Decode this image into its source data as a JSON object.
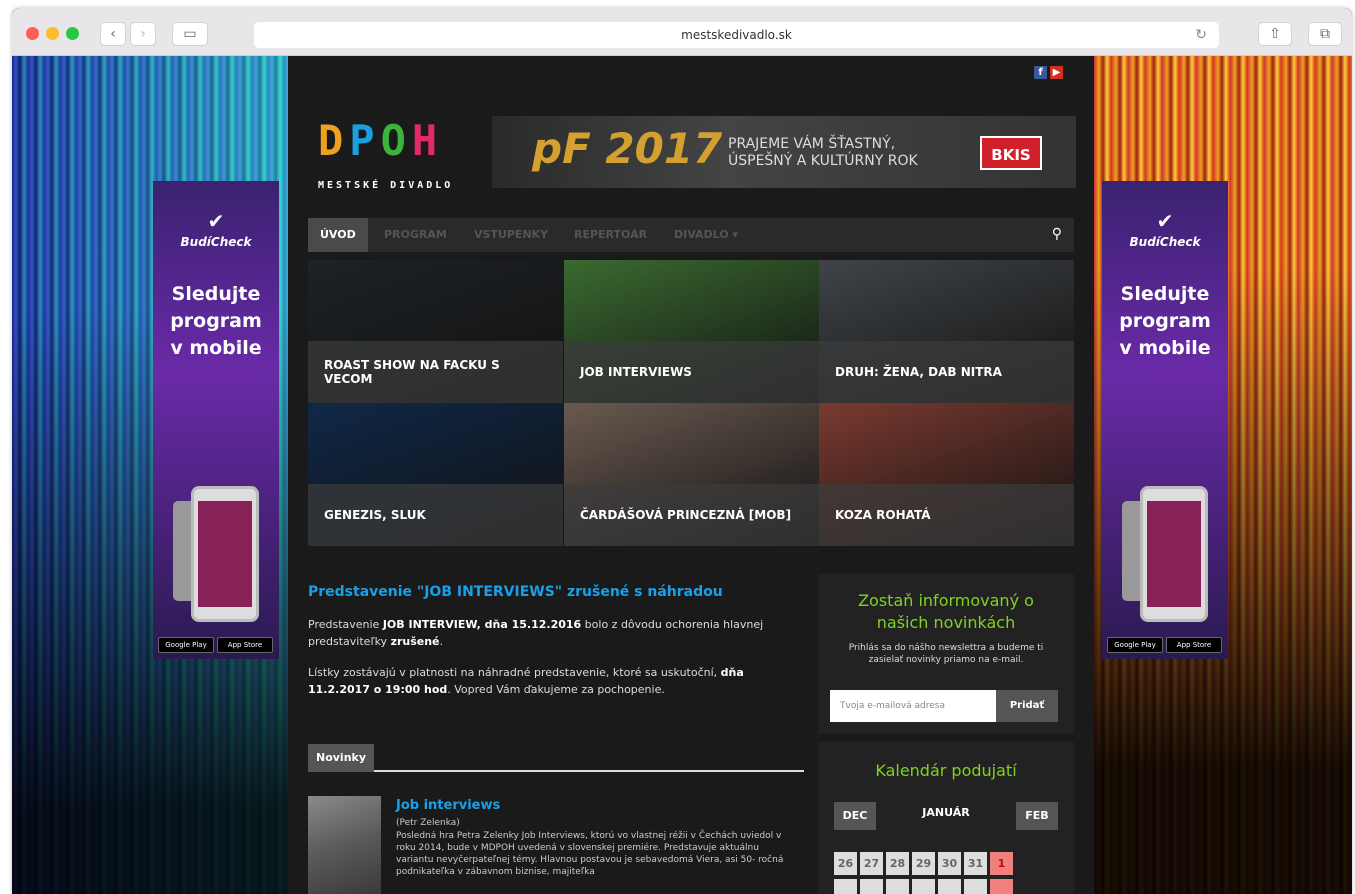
{
  "browser": {
    "url": "mestskedivadlo.sk"
  },
  "colors": {
    "accent_blue": "#18a0e8",
    "accent_green": "#7ed321",
    "bkis_red": "#d0202a"
  },
  "social": [
    {
      "name": "facebook-icon",
      "label": "f"
    },
    {
      "name": "youtube-icon",
      "label": "▶"
    }
  ],
  "header": {
    "logo_letters": [
      "D",
      "P",
      "O",
      "H"
    ],
    "logo_sub": "MESTSKÉ DIVADLO"
  },
  "banner": {
    "pf": "pF 2017",
    "line1": "PRAJEME VÁM ŠŤASTNÝ,",
    "line2": "ÚSPEŠNÝ A KULTÚRNY ROK",
    "badge": "BKIS"
  },
  "nav": {
    "items": [
      "ÚVOD",
      "PROGRAM",
      "VSTUPENKY",
      "REPERTOÁR",
      "DIVADLO ▾"
    ]
  },
  "tiles": [
    {
      "title": "ROAST SHOW NA FACKU S VECOM",
      "bg": "#1e2226"
    },
    {
      "title": "JOB INTERVIEWS",
      "bg": "#3a6a30"
    },
    {
      "title": "DRUH: ŽENA, DAB NITRA",
      "bg": "#404448"
    },
    {
      "title": "GENEZIS, SLUK",
      "bg": "#102848"
    },
    {
      "title": "ČARDÁŠOVÁ PRINCEZNÁ [MOB]",
      "bg": "#6a5a50"
    },
    {
      "title": "KOZA ROHATÁ",
      "bg": "#7a3a30"
    }
  ],
  "article": {
    "title": "Predstavenie \"JOB INTERVIEWS\" zrušené s náhradou",
    "p1_a": "Predstavenie ",
    "p1_b": "JOB INTERVIEW, dňa 15.12.2016",
    "p1_c": " bolo z dôvodu ochorenia hlavnej predstaviteľky ",
    "p1_d": "zrušené",
    "p1_e": ".",
    "p2_a": "Lístky zostávajú v platnosti na náhradné predstavenie, ktoré sa uskutoční, ",
    "p2_b": "dňa 11.2.2017 o 19:00 hod",
    "p2_c": ". Vopred Vám ďakujeme za pochopenie."
  },
  "news": {
    "tab": "Novinky",
    "title": "Job interviews",
    "author": "(Petr Zelenka)",
    "text": "Posledná hra Petra Zelenky Job Interviews, ktorú vo vlastnej réžii v Čechách uviedol v roku 2014, bude v MDPOH uvedená v slovenskej premiére. Predstavuje aktuálnu variantu nevyčerpateľnej témy. Hlavnou postavou je sebavedomá Viera, asi 50- ročná podnikateľka v zábavnom biznise, majiteľka"
  },
  "newsletter": {
    "heading": "Zostaň informovaný o našich novinkách",
    "sub": "Prihlás sa do nášho newslettra a budeme ti zasielať novinky priamo na e-mail.",
    "placeholder": "Tvoja e-mailová adresa",
    "button": "Pridať"
  },
  "calendar": {
    "heading": "Kalendár podujatí",
    "prev": "DEC",
    "month": "JANUÁR",
    "next": "FEB",
    "days": [
      "26",
      "27",
      "28",
      "29",
      "30",
      "31",
      "1"
    ]
  },
  "ads": {
    "brand": "BudíCheck",
    "line1": "Sledujte",
    "line2": "program",
    "line3": "v mobile",
    "gplay": "Google Play",
    "appstore": "App Store"
  }
}
